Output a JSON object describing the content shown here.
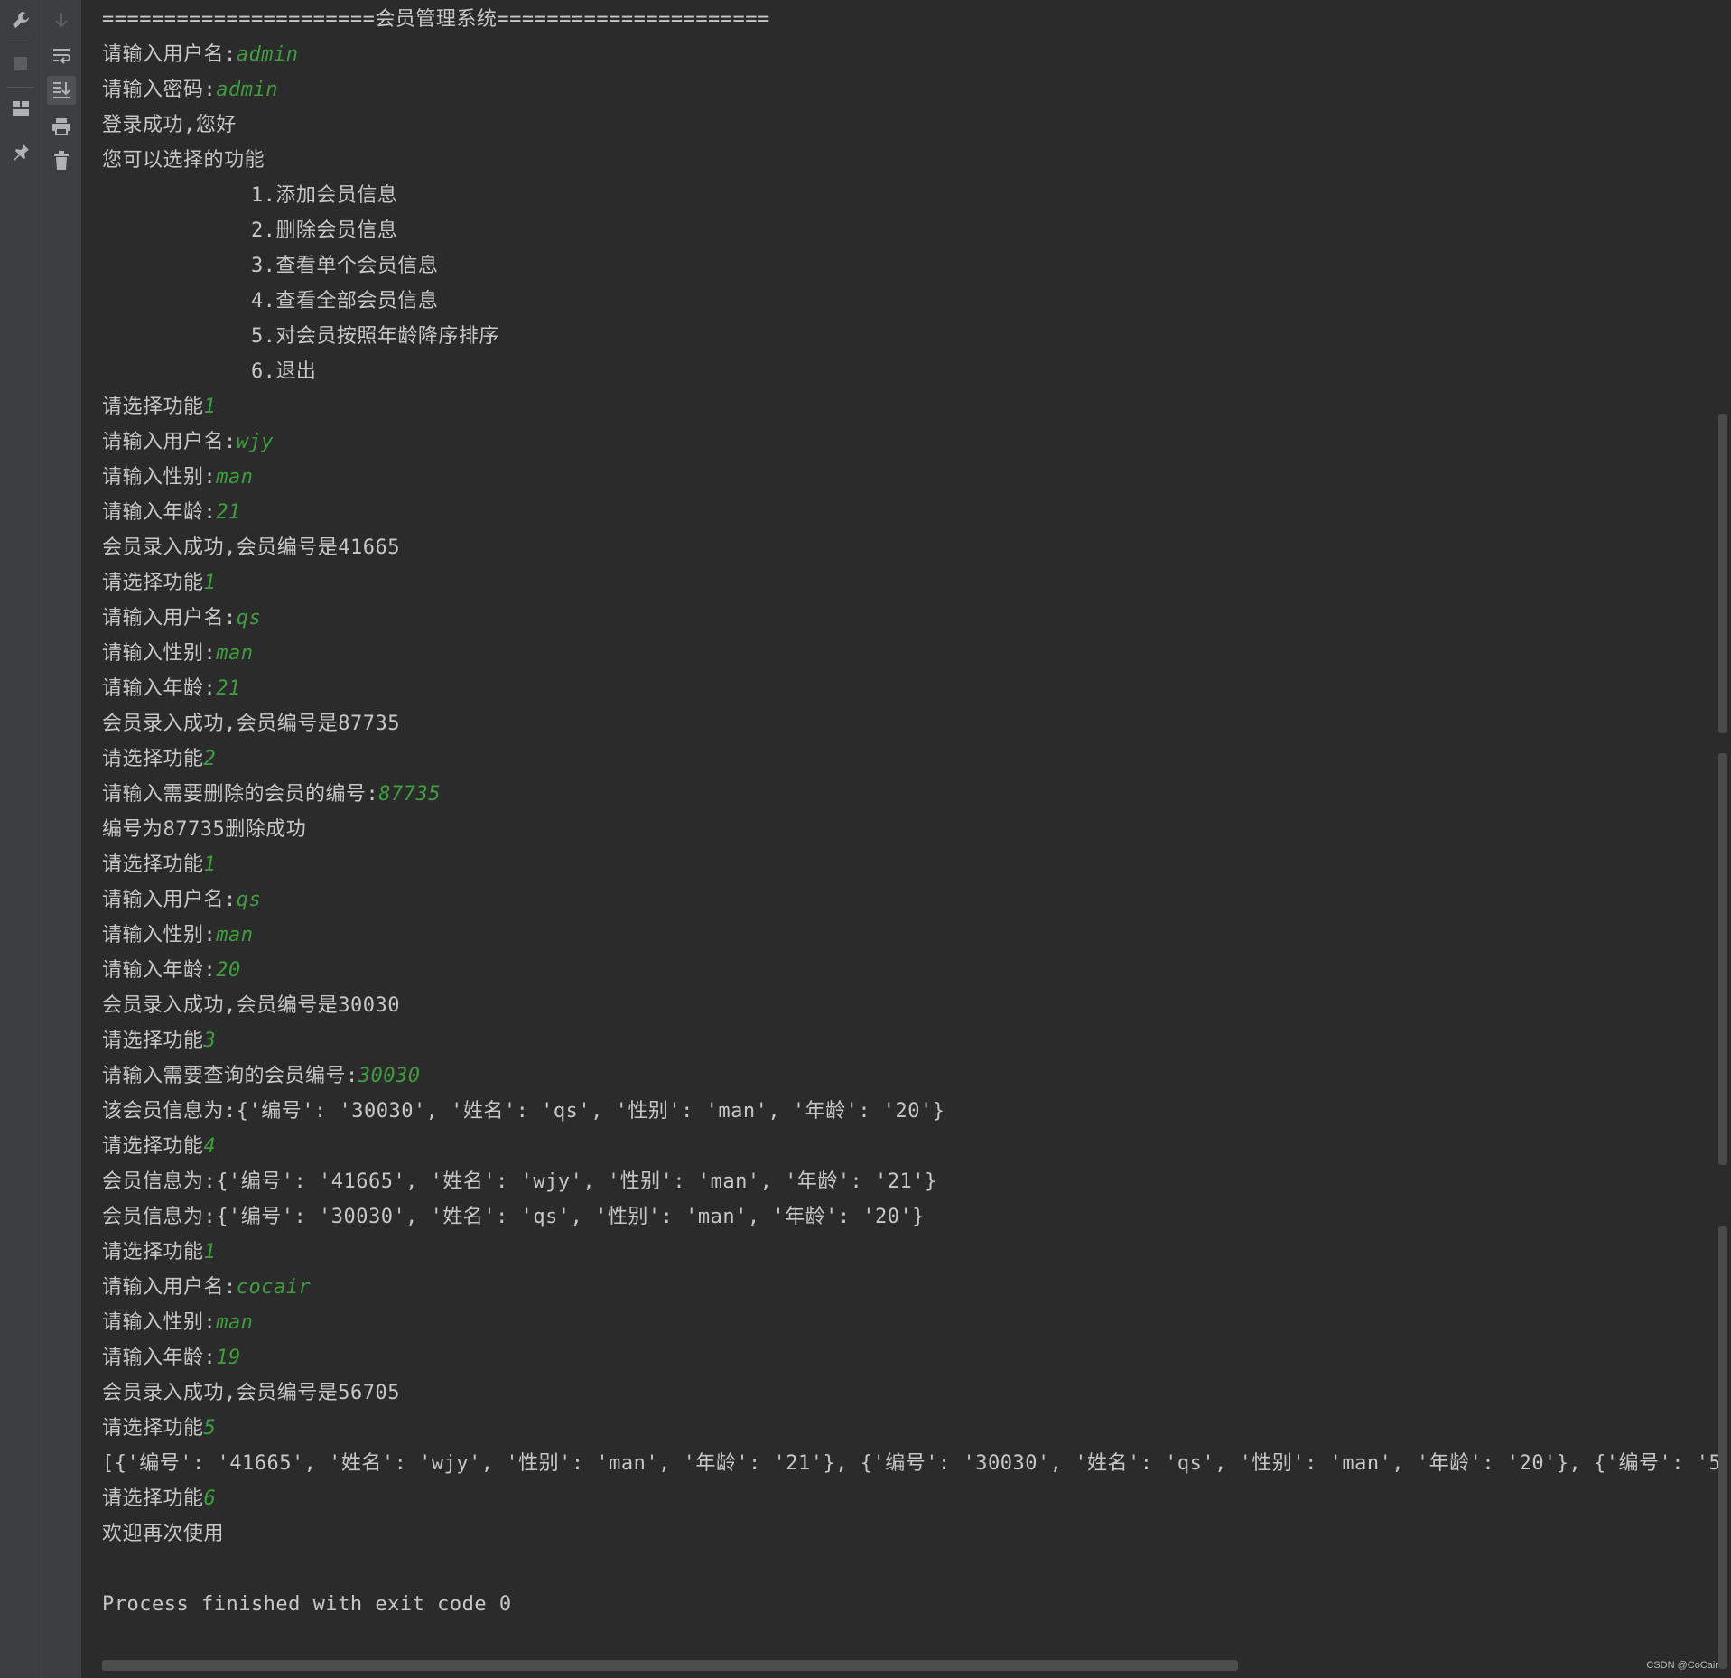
{
  "toolbar_left": {
    "icons": [
      "wrench-icon",
      "stop-icon",
      "layout-icon",
      "pin-icon"
    ]
  },
  "toolbar_right": {
    "icons": [
      "scroll-down-icon",
      "soft-wrap-icon",
      "scroll-to-end-icon",
      "print-icon",
      "trash-icon"
    ]
  },
  "console": {
    "lines": [
      {
        "text": "======================会员管理系统======================",
        "input": ""
      },
      {
        "text": "请输入用户名:",
        "input": "admin"
      },
      {
        "text": "请输入密码:",
        "input": "admin"
      },
      {
        "text": "登录成功,您好",
        "input": ""
      },
      {
        "text": "您可以选择的功能",
        "input": ""
      },
      {
        "text": "            1.添加会员信息",
        "input": ""
      },
      {
        "text": "            2.删除会员信息",
        "input": ""
      },
      {
        "text": "            3.查看单个会员信息",
        "input": ""
      },
      {
        "text": "            4.查看全部会员信息",
        "input": ""
      },
      {
        "text": "            5.对会员按照年龄降序排序",
        "input": ""
      },
      {
        "text": "            6.退出",
        "input": ""
      },
      {
        "text": "请选择功能",
        "input": "1"
      },
      {
        "text": "请输入用户名:",
        "input": "wjy"
      },
      {
        "text": "请输入性别:",
        "input": "man"
      },
      {
        "text": "请输入年龄:",
        "input": "21"
      },
      {
        "text": "会员录入成功,会员编号是41665",
        "input": ""
      },
      {
        "text": "请选择功能",
        "input": "1"
      },
      {
        "text": "请输入用户名:",
        "input": "qs"
      },
      {
        "text": "请输入性别:",
        "input": "man"
      },
      {
        "text": "请输入年龄:",
        "input": "21"
      },
      {
        "text": "会员录入成功,会员编号是87735",
        "input": ""
      },
      {
        "text": "请选择功能",
        "input": "2"
      },
      {
        "text": "请输入需要删除的会员的编号:",
        "input": "87735"
      },
      {
        "text": "编号为87735删除成功",
        "input": ""
      },
      {
        "text": "请选择功能",
        "input": "1"
      },
      {
        "text": "请输入用户名:",
        "input": "qs"
      },
      {
        "text": "请输入性别:",
        "input": "man"
      },
      {
        "text": "请输入年龄:",
        "input": "20"
      },
      {
        "text": "会员录入成功,会员编号是30030",
        "input": ""
      },
      {
        "text": "请选择功能",
        "input": "3"
      },
      {
        "text": "请输入需要查询的会员编号:",
        "input": "30030"
      },
      {
        "text": "该会员信息为:{'编号': '30030', '姓名': 'qs', '性别': 'man', '年龄': '20'}",
        "input": ""
      },
      {
        "text": "请选择功能",
        "input": "4"
      },
      {
        "text": "会员信息为:{'编号': '41665', '姓名': 'wjy', '性别': 'man', '年龄': '21'}",
        "input": ""
      },
      {
        "text": "会员信息为:{'编号': '30030', '姓名': 'qs', '性别': 'man', '年龄': '20'}",
        "input": ""
      },
      {
        "text": "请选择功能",
        "input": "1"
      },
      {
        "text": "请输入用户名:",
        "input": "cocair"
      },
      {
        "text": "请输入性别:",
        "input": "man"
      },
      {
        "text": "请输入年龄:",
        "input": "19"
      },
      {
        "text": "会员录入成功,会员编号是56705",
        "input": ""
      },
      {
        "text": "请选择功能",
        "input": "5"
      },
      {
        "text": "[{'编号': '41665', '姓名': 'wjy', '性别': 'man', '年龄': '21'}, {'编号': '30030', '姓名': 'qs', '性别': 'man', '年龄': '20'}, {'编号': '5",
        "input": ""
      },
      {
        "text": "请选择功能",
        "input": "6"
      },
      {
        "text": "欢迎再次使用",
        "input": ""
      },
      {
        "text": "",
        "input": ""
      },
      {
        "text": "Process finished with exit code 0",
        "input": ""
      }
    ]
  },
  "watermark": "CSDN @CoCair"
}
